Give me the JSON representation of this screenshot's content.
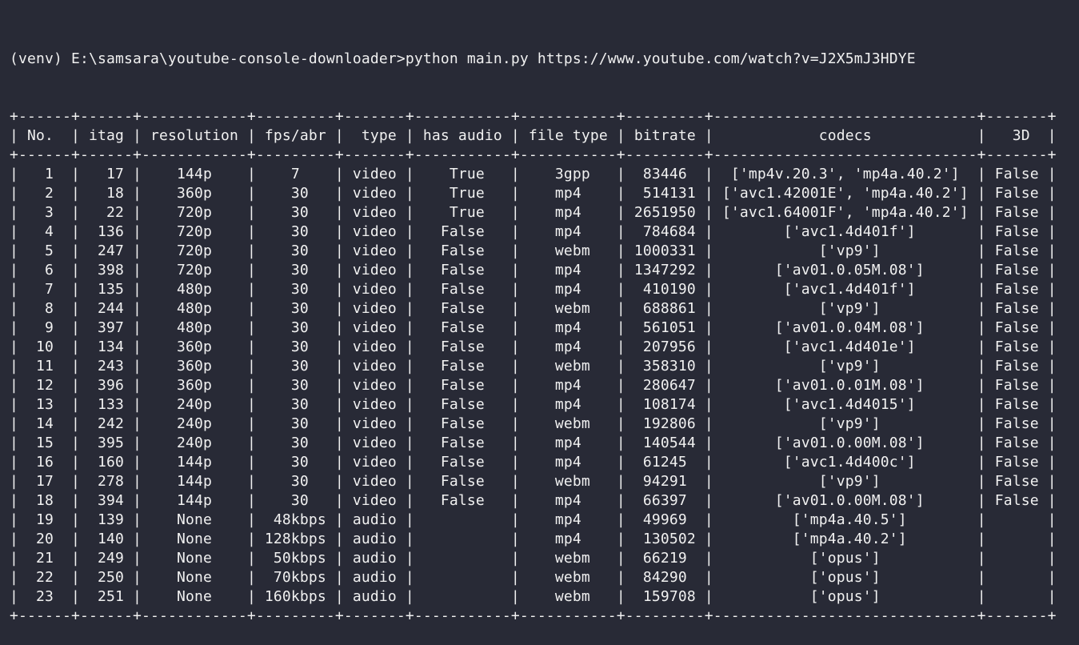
{
  "terminal": {
    "prompt": "(venv) E:\\samsara\\youtube-console-downloader>",
    "command": "python main.py https://www.youtube.com/watch?v=J2X5mJ3HDYE"
  },
  "table": {
    "columns": [
      {
        "key": "no",
        "label": "No.",
        "width": 6,
        "align": "center",
        "header_align": "left"
      },
      {
        "key": "itag",
        "label": "itag",
        "width": 6,
        "align": "right",
        "header_align": "center"
      },
      {
        "key": "resolution",
        "label": "resolution",
        "width": 12,
        "align": "center",
        "header_align": "center"
      },
      {
        "key": "fps_abr",
        "label": "fps/abr",
        "width": 9,
        "align": "center",
        "header_align": "center"
      },
      {
        "key": "type",
        "label": "type",
        "width": 7,
        "align": "center",
        "header_align": "right"
      },
      {
        "key": "has_audio",
        "label": "has audio",
        "width": 11,
        "align": "center",
        "header_align": "center"
      },
      {
        "key": "file_type",
        "label": "file type",
        "width": 11,
        "align": "center",
        "header_align": "center"
      },
      {
        "key": "bitrate",
        "label": "bitrate",
        "width": 9,
        "align": "center",
        "header_align": "center"
      },
      {
        "key": "codecs",
        "label": "codecs",
        "width": 30,
        "align": "center",
        "header_align": "center"
      },
      {
        "key": "threed",
        "label": "3D",
        "width": 7,
        "align": "center",
        "header_align": "center"
      }
    ],
    "rows": [
      {
        "no": "1",
        "itag": "17",
        "resolution": "144p",
        "fps_abr": "7",
        "type": "video",
        "has_audio": "True",
        "file_type": "3gpp",
        "bitrate": "83446",
        "codecs": "['mp4v.20.3', 'mp4a.40.2']",
        "threed": "False"
      },
      {
        "no": "2",
        "itag": "18",
        "resolution": "360p",
        "fps_abr": "30",
        "type": "video",
        "has_audio": "True",
        "file_type": "mp4",
        "bitrate": "514131",
        "codecs": "['avc1.42001E', 'mp4a.40.2']",
        "threed": "False"
      },
      {
        "no": "3",
        "itag": "22",
        "resolution": "720p",
        "fps_abr": "30",
        "type": "video",
        "has_audio": "True",
        "file_type": "mp4",
        "bitrate": "2651950",
        "codecs": "['avc1.64001F', 'mp4a.40.2']",
        "threed": "False"
      },
      {
        "no": "4",
        "itag": "136",
        "resolution": "720p",
        "fps_abr": "30",
        "type": "video",
        "has_audio": "False",
        "file_type": "mp4",
        "bitrate": "784684",
        "codecs": "['avc1.4d401f']",
        "threed": "False"
      },
      {
        "no": "5",
        "itag": "247",
        "resolution": "720p",
        "fps_abr": "30",
        "type": "video",
        "has_audio": "False",
        "file_type": "webm",
        "bitrate": "1000331",
        "codecs": "['vp9']",
        "threed": "False"
      },
      {
        "no": "6",
        "itag": "398",
        "resolution": "720p",
        "fps_abr": "30",
        "type": "video",
        "has_audio": "False",
        "file_type": "mp4",
        "bitrate": "1347292",
        "codecs": "['av01.0.05M.08']",
        "threed": "False"
      },
      {
        "no": "7",
        "itag": "135",
        "resolution": "480p",
        "fps_abr": "30",
        "type": "video",
        "has_audio": "False",
        "file_type": "mp4",
        "bitrate": "410190",
        "codecs": "['avc1.4d401f']",
        "threed": "False"
      },
      {
        "no": "8",
        "itag": "244",
        "resolution": "480p",
        "fps_abr": "30",
        "type": "video",
        "has_audio": "False",
        "file_type": "webm",
        "bitrate": "688861",
        "codecs": "['vp9']",
        "threed": "False"
      },
      {
        "no": "9",
        "itag": "397",
        "resolution": "480p",
        "fps_abr": "30",
        "type": "video",
        "has_audio": "False",
        "file_type": "mp4",
        "bitrate": "561051",
        "codecs": "['av01.0.04M.08']",
        "threed": "False"
      },
      {
        "no": "10",
        "itag": "134",
        "resolution": "360p",
        "fps_abr": "30",
        "type": "video",
        "has_audio": "False",
        "file_type": "mp4",
        "bitrate": "207956",
        "codecs": "['avc1.4d401e']",
        "threed": "False"
      },
      {
        "no": "11",
        "itag": "243",
        "resolution": "360p",
        "fps_abr": "30",
        "type": "video",
        "has_audio": "False",
        "file_type": "webm",
        "bitrate": "358310",
        "codecs": "['vp9']",
        "threed": "False"
      },
      {
        "no": "12",
        "itag": "396",
        "resolution": "360p",
        "fps_abr": "30",
        "type": "video",
        "has_audio": "False",
        "file_type": "mp4",
        "bitrate": "280647",
        "codecs": "['av01.0.01M.08']",
        "threed": "False"
      },
      {
        "no": "13",
        "itag": "133",
        "resolution": "240p",
        "fps_abr": "30",
        "type": "video",
        "has_audio": "False",
        "file_type": "mp4",
        "bitrate": "108174",
        "codecs": "['avc1.4d4015']",
        "threed": "False"
      },
      {
        "no": "14",
        "itag": "242",
        "resolution": "240p",
        "fps_abr": "30",
        "type": "video",
        "has_audio": "False",
        "file_type": "webm",
        "bitrate": "192806",
        "codecs": "['vp9']",
        "threed": "False"
      },
      {
        "no": "15",
        "itag": "395",
        "resolution": "240p",
        "fps_abr": "30",
        "type": "video",
        "has_audio": "False",
        "file_type": "mp4",
        "bitrate": "140544",
        "codecs": "['av01.0.00M.08']",
        "threed": "False"
      },
      {
        "no": "16",
        "itag": "160",
        "resolution": "144p",
        "fps_abr": "30",
        "type": "video",
        "has_audio": "False",
        "file_type": "mp4",
        "bitrate": "61245",
        "codecs": "['avc1.4d400c']",
        "threed": "False"
      },
      {
        "no": "17",
        "itag": "278",
        "resolution": "144p",
        "fps_abr": "30",
        "type": "video",
        "has_audio": "False",
        "file_type": "webm",
        "bitrate": "94291",
        "codecs": "['vp9']",
        "threed": "False"
      },
      {
        "no": "18",
        "itag": "394",
        "resolution": "144p",
        "fps_abr": "30",
        "type": "video",
        "has_audio": "False",
        "file_type": "mp4",
        "bitrate": "66397",
        "codecs": "['av01.0.00M.08']",
        "threed": "False"
      },
      {
        "no": "19",
        "itag": "139",
        "resolution": "None",
        "fps_abr": "48kbps",
        "type": "audio",
        "has_audio": "",
        "file_type": "mp4",
        "bitrate": "49969",
        "codecs": "['mp4a.40.5']",
        "threed": ""
      },
      {
        "no": "20",
        "itag": "140",
        "resolution": "None",
        "fps_abr": "128kbps",
        "type": "audio",
        "has_audio": "",
        "file_type": "mp4",
        "bitrate": "130502",
        "codecs": "['mp4a.40.2']",
        "threed": ""
      },
      {
        "no": "21",
        "itag": "249",
        "resolution": "None",
        "fps_abr": "50kbps",
        "type": "audio",
        "has_audio": "",
        "file_type": "webm",
        "bitrate": "66219",
        "codecs": "['opus']",
        "threed": ""
      },
      {
        "no": "22",
        "itag": "250",
        "resolution": "None",
        "fps_abr": "70kbps",
        "type": "audio",
        "has_audio": "",
        "file_type": "webm",
        "bitrate": "84290",
        "codecs": "['opus']",
        "threed": ""
      },
      {
        "no": "23",
        "itag": "251",
        "resolution": "None",
        "fps_abr": "160kbps",
        "type": "audio",
        "has_audio": "",
        "file_type": "webm",
        "bitrate": "159708",
        "codecs": "['opus']",
        "threed": ""
      }
    ]
  },
  "colors": {
    "background": "#282a36",
    "foreground": "#f1f1f1"
  }
}
